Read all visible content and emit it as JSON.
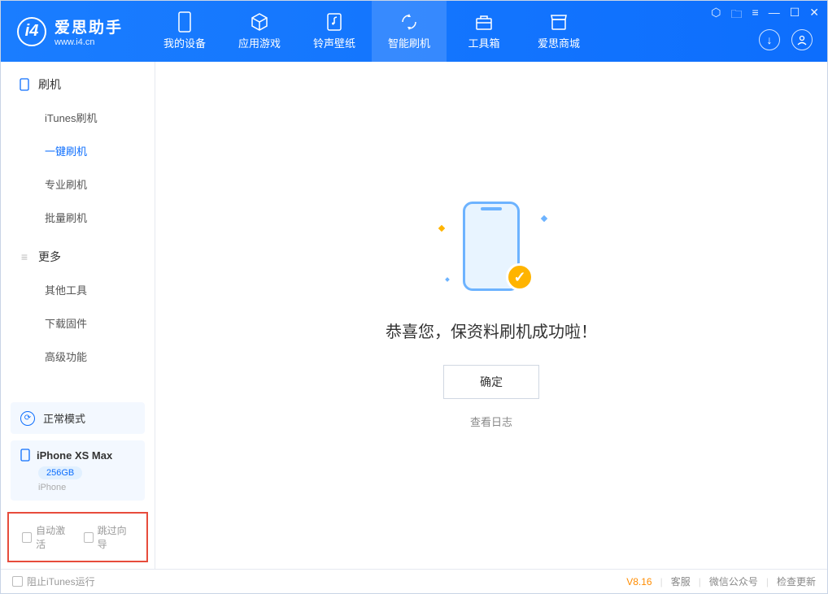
{
  "app": {
    "title": "爱思助手",
    "url": "www.i4.cn"
  },
  "nav": [
    {
      "label": "我的设备",
      "icon": "phone"
    },
    {
      "label": "应用游戏",
      "icon": "cube"
    },
    {
      "label": "铃声壁纸",
      "icon": "music"
    },
    {
      "label": "智能刷机",
      "icon": "refresh",
      "active": true
    },
    {
      "label": "工具箱",
      "icon": "toolbox"
    },
    {
      "label": "爱思商城",
      "icon": "store"
    }
  ],
  "sidebar": {
    "section1": {
      "title": "刷机",
      "items": [
        {
          "label": "iTunes刷机"
        },
        {
          "label": "一键刷机",
          "active": true
        },
        {
          "label": "专业刷机"
        },
        {
          "label": "批量刷机"
        }
      ]
    },
    "section2": {
      "title": "更多",
      "items": [
        {
          "label": "其他工具"
        },
        {
          "label": "下载固件"
        },
        {
          "label": "高级功能"
        }
      ]
    }
  },
  "device_status": {
    "label": "正常模式"
  },
  "device": {
    "name": "iPhone XS Max",
    "storage": "256GB",
    "type": "iPhone"
  },
  "options": {
    "auto_activate": "自动激活",
    "skip_guide": "跳过向导"
  },
  "main": {
    "title": "恭喜您，保资料刷机成功啦！",
    "confirm": "确定",
    "log_link": "查看日志"
  },
  "footer": {
    "block_itunes": "阻止iTunes运行",
    "version": "V8.16",
    "links": [
      "客服",
      "微信公众号",
      "检查更新"
    ]
  }
}
